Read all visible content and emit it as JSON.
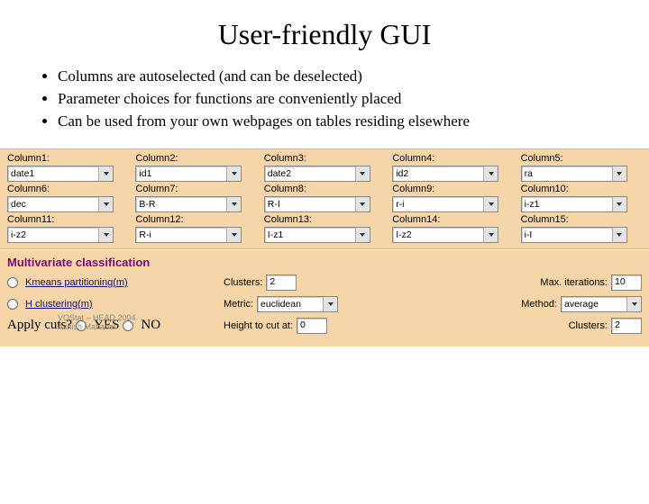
{
  "title": "User-friendly GUI",
  "bullets": [
    "Columns are autoselected (and can be deselected)",
    "Parameter choices for functions are conveniently placed",
    "Can be used from your own webpages on tables residing elsewhere"
  ],
  "columns": [
    {
      "label": "Column1:",
      "value": "date1"
    },
    {
      "label": "Column2:",
      "value": "id1"
    },
    {
      "label": "Column3:",
      "value": "date2"
    },
    {
      "label": "Column4:",
      "value": "id2"
    },
    {
      "label": "Column5:",
      "value": "ra"
    },
    {
      "label": "Column6:",
      "value": "dec"
    },
    {
      "label": "Column7:",
      "value": "B-R"
    },
    {
      "label": "Column8:",
      "value": "R-I"
    },
    {
      "label": "Column9:",
      "value": "r-i"
    },
    {
      "label": "Column10:",
      "value": "i-z1"
    },
    {
      "label": "Column11:",
      "value": "i-z2"
    },
    {
      "label": "Column12:",
      "value": "R-i"
    },
    {
      "label": "Column13:",
      "value": "I-z1"
    },
    {
      "label": "Column14:",
      "value": "I-z2"
    },
    {
      "label": "Column15:",
      "value": "i-I"
    }
  ],
  "mv": {
    "title": "Multivariate classification",
    "kmeans": "Kmeans partitioning(m)",
    "hclust": "H clustering(m)",
    "clusters_label": "Clusters:",
    "clusters_value": "2",
    "maxiter_label": "Max. iterations:",
    "maxiter_value": "10",
    "metric_label": "Metric:",
    "metric_value": "euclidean",
    "method_label": "Method:",
    "method_value": "average",
    "applycuts_label": "Apply cuts?",
    "yes": "YES",
    "no": "NO",
    "height_label": "Height to cut at:",
    "height_value": "0",
    "clusters2_label": "Clusters:",
    "clusters2_value": "2"
  },
  "footer": {
    "line1": "VOStat – HEAD 2004",
    "line2": "Ashish Mahabal"
  }
}
